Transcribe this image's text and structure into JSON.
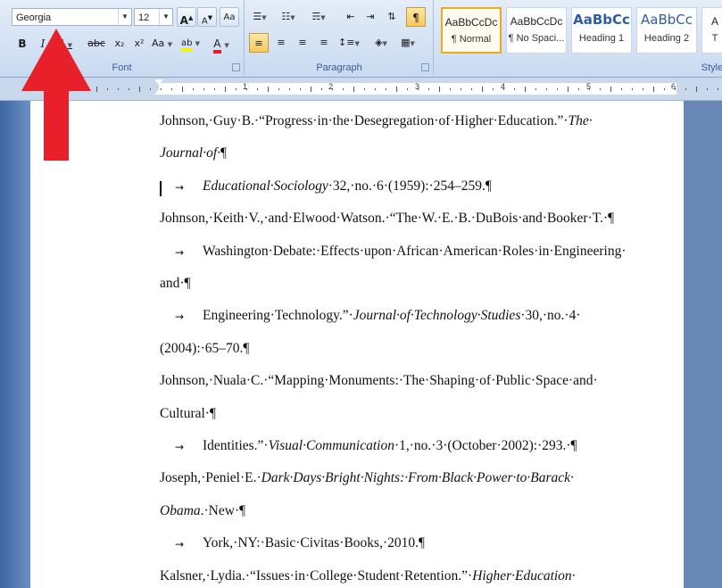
{
  "ribbon": {
    "font_group": {
      "label": "Font",
      "font_name": "Georgia",
      "font_size": "12",
      "grow_font": "A",
      "shrink_font": "A",
      "clear_format": "Aa",
      "bold": "B",
      "italic": "I",
      "underline": "U",
      "strikethrough": "abc",
      "subscript": "x₂",
      "superscript": "x²",
      "change_case": "Aa",
      "highlight": "ab",
      "font_color": "A"
    },
    "paragraph_group": {
      "label": "Paragraph",
      "show_marks": "¶"
    },
    "styles_group": {
      "label": "Style",
      "styles": [
        {
          "sample": "AaBbCcDc",
          "name": "¶ Normal"
        },
        {
          "sample": "AaBbCcDc",
          "name": "¶ No Spaci..."
        },
        {
          "sample": "AaBbCc",
          "name": "Heading 1"
        },
        {
          "sample": "AaBbCc",
          "name": "Heading 2"
        },
        {
          "sample": "A",
          "name": "T"
        }
      ]
    }
  },
  "ruler": {
    "numbers": [
      "1",
      "2",
      "3",
      "4",
      "5",
      "6"
    ]
  },
  "document": {
    "lines": [
      {
        "segments": [
          {
            "t": "Johnson,·Guy·B.·“Progress·in·the·Desegregation·of·Higher·Education.”·"
          },
          {
            "t": "The·",
            "i": true
          }
        ]
      },
      {
        "segments": [
          {
            "t": "Journal·of·",
            "i": true
          },
          {
            "t": "¶"
          }
        ]
      },
      {
        "tab": true,
        "segments": [
          {
            "t": "Educational·Sociology",
            "i": true
          },
          {
            "t": "·32,·no.·6·(1959):·254–259.¶"
          }
        ]
      },
      {
        "segments": [
          {
            "t": "Johnson,·Keith·V.,·and·Elwood·Watson.·“The·W.·E.·B.·DuBois·and·Booker·T.·¶"
          }
        ]
      },
      {
        "tab": true,
        "segments": [
          {
            "t": "Washington·Debate:·Effects·upon·African·American·Roles·in·Engineering·"
          }
        ]
      },
      {
        "segments": [
          {
            "t": "and·¶"
          }
        ]
      },
      {
        "tab": true,
        "segments": [
          {
            "t": "Engineering·Technology.”·"
          },
          {
            "t": "Journal·of·Technology·Studies",
            "i": true
          },
          {
            "t": "·30,·no.·4·"
          }
        ]
      },
      {
        "segments": [
          {
            "t": "(2004):·65–70.¶"
          }
        ]
      },
      {
        "segments": [
          {
            "t": "Johnson,·Nuala·C.·“Mapping·Monuments:·The·Shaping·of·Public·Space·and·"
          }
        ]
      },
      {
        "segments": [
          {
            "t": "Cultural·¶"
          }
        ]
      },
      {
        "tab": true,
        "segments": [
          {
            "t": "Identities.”·"
          },
          {
            "t": "Visual·Communication",
            "i": true
          },
          {
            "t": "·1,·no.·3·(October·2002):·293.·¶"
          }
        ]
      },
      {
        "segments": [
          {
            "t": "Joseph,·Peniel·E.·"
          },
          {
            "t": "Dark·Days·Bright·Nights:·From·Black·Power·to·Barack·",
            "i": true
          }
        ]
      },
      {
        "segments": [
          {
            "t": "Obama",
            "i": true
          },
          {
            "t": ".·New·¶"
          }
        ]
      },
      {
        "tab": true,
        "segments": [
          {
            "t": "York,·NY:·Basic·Civitas·Books,·2010.¶"
          }
        ]
      },
      {
        "segments": [
          {
            "t": "Kalsner,·Lydia.·“Issues·in·College·Student·Retention.”·"
          },
          {
            "t": "Higher·Education·",
            "i": true
          }
        ]
      }
    ]
  },
  "tab_arrow": "→",
  "colors": {
    "annotation_arrow": "#e8202a",
    "font_color_bar": "#e02020",
    "highlight_bar": "#f5f500"
  }
}
